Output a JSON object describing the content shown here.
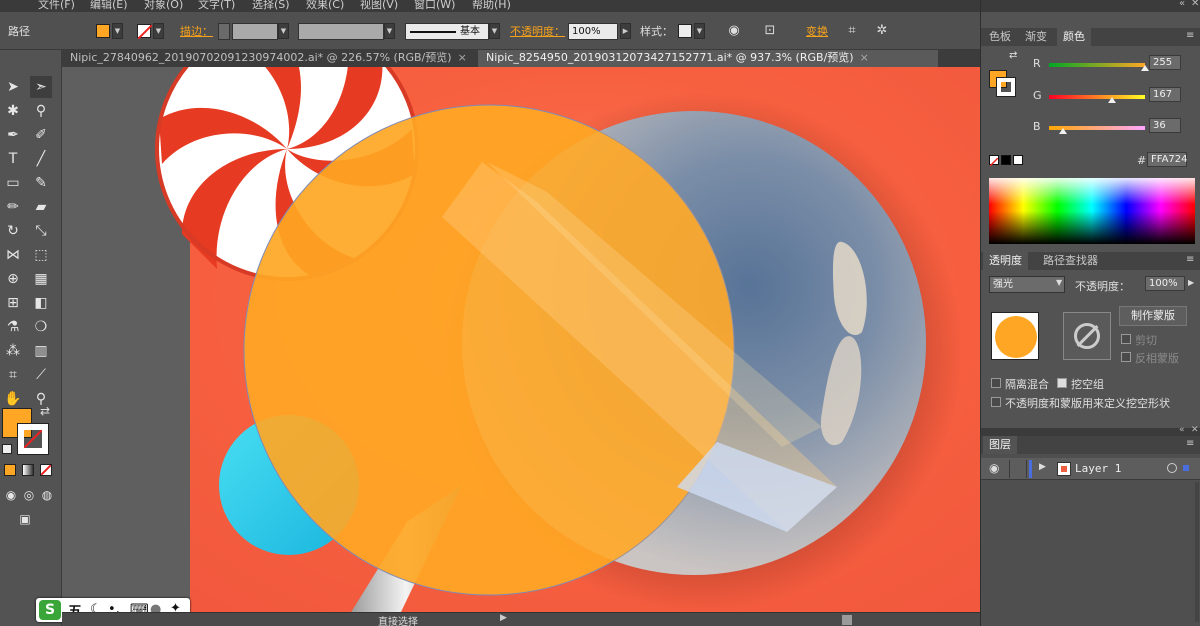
{
  "menu": {
    "items": [
      "文件(F)",
      "编辑(E)",
      "对象(O)",
      "文字(T)",
      "选择(S)",
      "效果(C)",
      "视图(V)",
      "窗口(W)",
      "帮助(H)"
    ]
  },
  "control_bar": {
    "object_type": "路径",
    "fill_color": "#ffa724",
    "stroke_label": "描边：",
    "stroke_style": "基本",
    "opacity_label": "不透明度：",
    "opacity_value": "100%",
    "style_label": "样式：",
    "transform_label": "变换"
  },
  "tabs": [
    {
      "title": "Nipic_27840962_20190702091230974002.ai* @ 226.57% (RGB/预览)",
      "close": "×"
    },
    {
      "title": "Nipic_8254950_20190312073427152771.ai* @ 937.3% (RGB/预览)",
      "close": "×"
    }
  ],
  "color_panel": {
    "tabs": [
      "色板",
      "渐变",
      "颜色"
    ],
    "active_tab": "颜色",
    "channels": [
      {
        "label": "R",
        "value": "255",
        "level": 1.0
      },
      {
        "label": "G",
        "value": "167",
        "level": 0.655
      },
      {
        "label": "B",
        "value": "36",
        "level": 0.141
      }
    ],
    "hash": "#",
    "hex": "FFA724"
  },
  "transparency_panel": {
    "tabs": [
      "透明度",
      "路径查找器"
    ],
    "active_tab": "透明度",
    "blend_mode": "强光",
    "opacity_label": "不透明度：",
    "opacity_value": "100%",
    "make_mask_button": "制作蒙版",
    "clip_label": "剪切",
    "invert_mask_label": "反相蒙版",
    "isolate_blending_label": "隔离混合",
    "knockout_group_label": "挖空组",
    "opacity_mask_define_label": "不透明度和蒙版用来定义挖空形状"
  },
  "layers_panel": {
    "tab": "图层",
    "layers": [
      {
        "name": "Layer 1"
      }
    ]
  },
  "status_bar": {
    "tool_name": "直接选择"
  },
  "ime_bar": {
    "logo": "S",
    "mode": "五"
  },
  "colors": {
    "accent_orange": "#f7a21b",
    "fill": "#ffa724",
    "artboard_bg": "#f0553b"
  }
}
